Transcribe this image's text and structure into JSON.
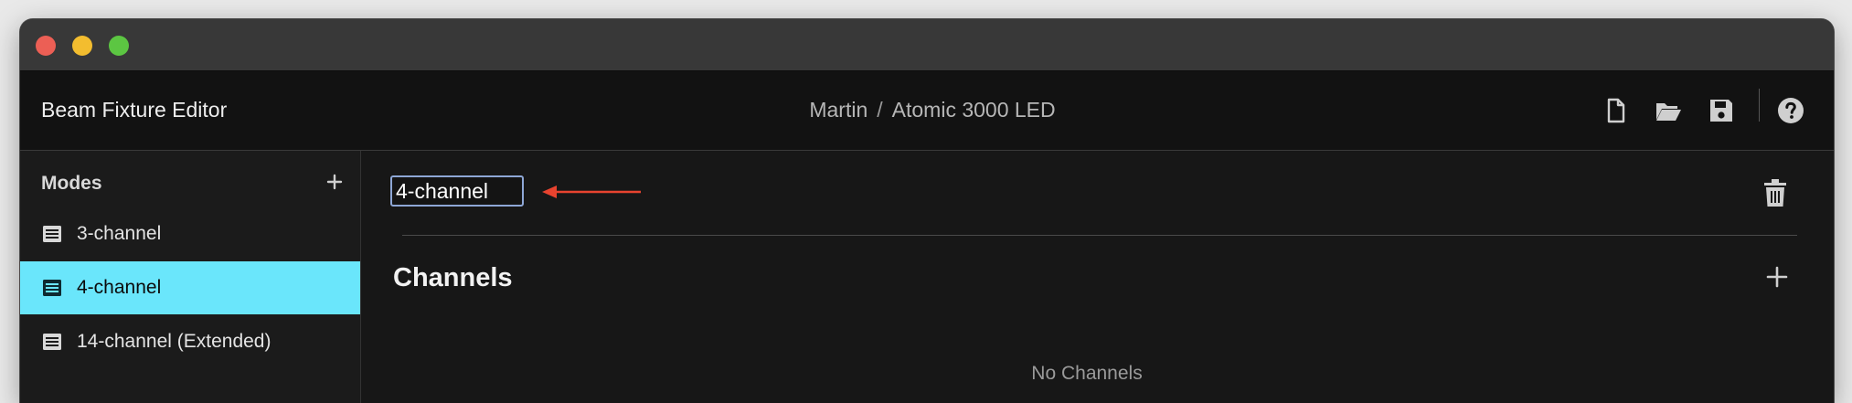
{
  "app": {
    "title": "Beam Fixture Editor"
  },
  "breadcrumb": {
    "manufacturer": "Martin",
    "separator": "/",
    "fixture": "Atomic 3000 LED"
  },
  "toolbar": {
    "icons": [
      "new-file-icon",
      "open-folder-icon",
      "save-icon",
      "help-icon"
    ]
  },
  "sidebar": {
    "title": "Modes",
    "items": [
      {
        "label": "3-channel",
        "selected": false
      },
      {
        "label": "4-channel",
        "selected": true
      },
      {
        "label": "14-channel (Extended)",
        "selected": false
      }
    ]
  },
  "main": {
    "mode_name_value": "4-channel",
    "channels_title": "Channels",
    "empty_message": "No Channels"
  },
  "colors": {
    "accent_selected": "#6ae6fb",
    "annotation_arrow": "#e8432f",
    "input_border": "#8ea7d6",
    "background": "#171717"
  }
}
